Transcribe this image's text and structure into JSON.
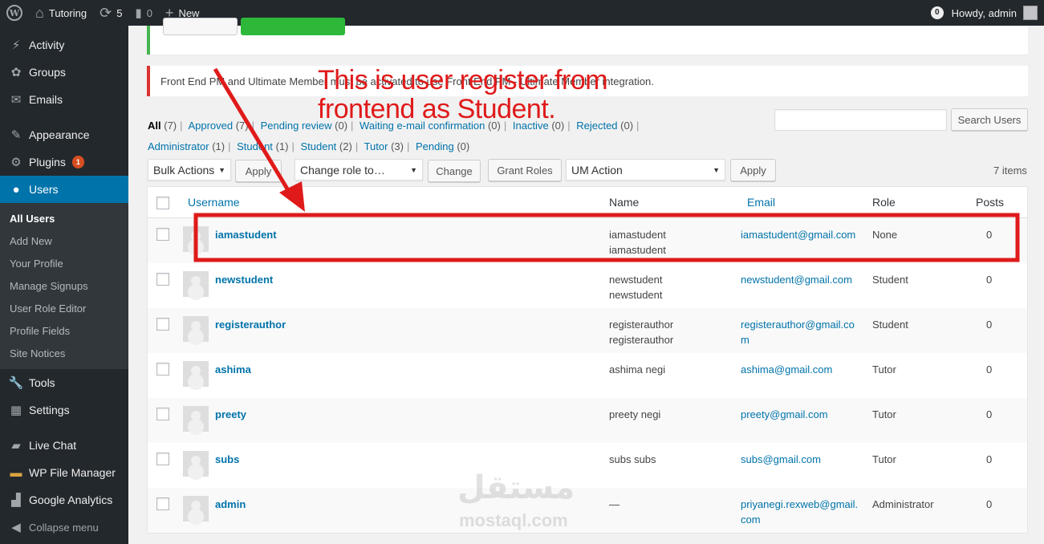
{
  "adminbar": {
    "site_name": "Tutoring",
    "updates_count": "5",
    "comments_count": "0",
    "new_label": "New",
    "notifications_count": "0",
    "greeting": "Howdy, admin"
  },
  "sidebar": {
    "items": [
      {
        "label": "Activity",
        "icon": "activity-icon"
      },
      {
        "label": "Groups",
        "icon": "groups-icon"
      },
      {
        "label": "Emails",
        "icon": "mail-icon"
      },
      {
        "label": "Appearance",
        "icon": "brush-icon"
      },
      {
        "label": "Plugins",
        "icon": "plugin-icon",
        "badge": "1"
      },
      {
        "label": "Users",
        "icon": "user-icon"
      },
      {
        "label": "Tools",
        "icon": "wrench-icon"
      },
      {
        "label": "Settings",
        "icon": "settings-icon"
      },
      {
        "label": "Live Chat",
        "icon": "chat-icon"
      },
      {
        "label": "WP File Manager",
        "icon": "folder-icon"
      },
      {
        "label": "Google Analytics",
        "icon": "chart-icon"
      }
    ],
    "submenu": [
      "All Users",
      "Add New",
      "Your Profile",
      "Manage Signups",
      "User Role Editor",
      "Profile Fields",
      "Site Notices"
    ],
    "collapse_label": "Collapse menu"
  },
  "notice": {
    "error_text": "Front End PM and Ultimate Member must be activated to use Front End PM - Ultimate Member integration."
  },
  "views": {
    "all": "All",
    "all_count": "(7)",
    "approved": "Approved",
    "approved_count": "(7)",
    "pending_review": "Pending review",
    "pending_review_count": "(0)",
    "waiting": "Waiting e-mail confirmation",
    "waiting_count": "(0)",
    "inactive": "Inactive",
    "inactive_count": "(0)",
    "rejected": "Rejected",
    "rejected_count": "(0)",
    "administrator": "Administrator",
    "administrator_count": "(1)",
    "student1": "Student",
    "student1_count": "(1)",
    "student2": "Student",
    "student2_count": "(2)",
    "tutor": "Tutor",
    "tutor_count": "(3)",
    "pending": "Pending",
    "pending_count": "(0)"
  },
  "toolbar": {
    "search_placeholder": "",
    "search_button": "Search Users",
    "bulk_actions": "Bulk Actions",
    "apply": "Apply",
    "change_role": "Change role to…",
    "change": "Change",
    "grant_roles": "Grant Roles",
    "um_action": "UM Action",
    "apply2": "Apply",
    "items_count": "7 items"
  },
  "table": {
    "headers": {
      "username": "Username",
      "name": "Name",
      "email": "Email",
      "role": "Role",
      "posts": "Posts"
    },
    "rows": [
      {
        "username": "iamastudent",
        "name1": "iamastudent",
        "name2": "iamastudent",
        "email": "iamastudent@gmail.com",
        "role": "None",
        "posts": "0"
      },
      {
        "username": "newstudent",
        "name1": "newstudent",
        "name2": "newstudent",
        "email": "newstudent@gmail.com",
        "role": "Student",
        "posts": "0"
      },
      {
        "username": "registerauthor",
        "name1": "registerauthor",
        "name2": "registerauthor",
        "email": "registerauthor@gmail.com",
        "role": "Student",
        "posts": "0"
      },
      {
        "username": "ashima",
        "name1": "ashima negi",
        "name2": "",
        "email": "ashima@gmail.com",
        "role": "Tutor",
        "posts": "0"
      },
      {
        "username": "preety",
        "name1": "preety negi",
        "name2": "",
        "email": "preety@gmail.com",
        "role": "Tutor",
        "posts": "0"
      },
      {
        "username": "subs",
        "name1": "subs subs",
        "name2": "",
        "email": "subs@gmail.com",
        "role": "Tutor",
        "posts": "0"
      },
      {
        "username": "admin",
        "name1": "—",
        "name2": "",
        "email": "priyanegi.rexweb@gmail.com",
        "role": "Administrator",
        "posts": "0"
      }
    ]
  },
  "annotation": {
    "line1": "This is user register from",
    "line2": "frontend as Student.",
    "color": "#e01a1a"
  },
  "watermark": {
    "arabic": "مستقل",
    "latin": "mostaql.com"
  }
}
